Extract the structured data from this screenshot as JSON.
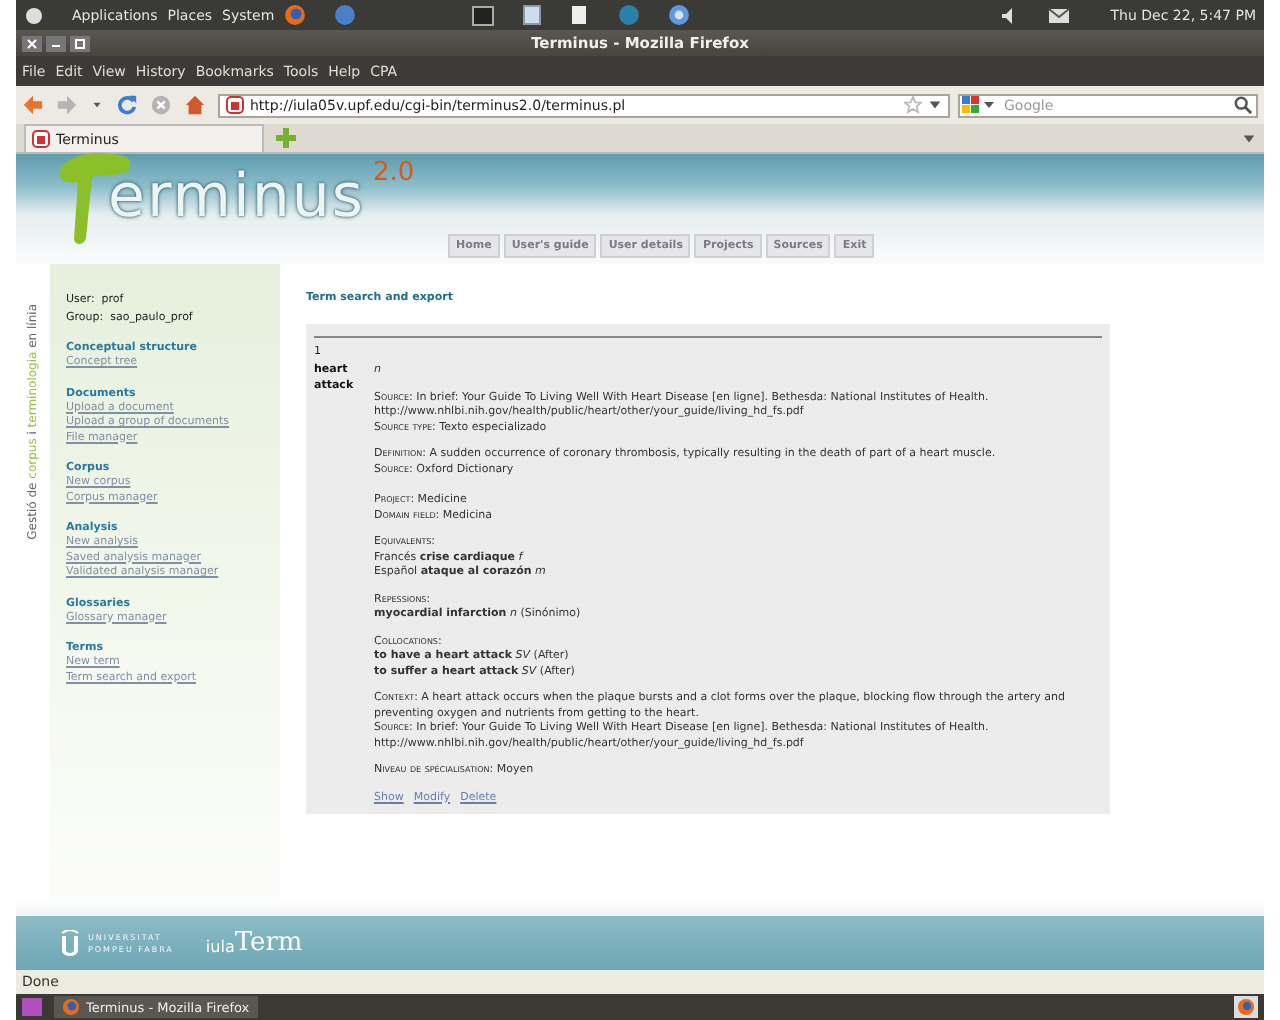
{
  "top_panel": {
    "menus": [
      "Applications",
      "Places",
      "System"
    ],
    "clock": "Thu Dec 22,  5:47 PM"
  },
  "window": {
    "title": "Terminus - Mozilla Firefox"
  },
  "menubar": [
    "File",
    "Edit",
    "View",
    "History",
    "Bookmarks",
    "Tools",
    "Help",
    "CPA"
  ],
  "toolbar": {
    "buttons": [
      {
        "kind": "back",
        "disabled": false
      },
      {
        "kind": "forward",
        "disabled": true
      },
      {
        "kind": "history",
        "disabled": false
      },
      {
        "kind": "reload",
        "disabled": false
      },
      {
        "kind": "stop",
        "disabled": true
      },
      {
        "kind": "home",
        "disabled": false
      }
    ],
    "url": "http://iula05v.upf.edu/cgi-bin/terminus2.0/terminus.pl",
    "search": {
      "placeholder": "Google"
    }
  },
  "tabs": [
    {
      "label": "Terminus",
      "selected": true
    }
  ],
  "site": {
    "logo": "erminus",
    "version": "2.0",
    "nav": [
      "Home",
      "User's guide",
      "User details",
      "Projects",
      "Sources",
      "Exit"
    ],
    "side_caption": [
      {
        "text": "Gestió de ",
        "highlight": false
      },
      {
        "text": "corpus",
        "highlight": true
      },
      {
        "text": " i ",
        "highlight": false
      },
      {
        "text": "terminologia",
        "highlight": true
      },
      {
        "text": " en línia",
        "highlight": false
      }
    ],
    "user": [
      {
        "label": "User:",
        "value": "prof"
      },
      {
        "label": "Group:",
        "value": "sao_paulo_prof"
      }
    ],
    "sidebar": [
      {
        "title": "Conceptual structure",
        "links": [
          "Concept tree"
        ]
      },
      {
        "title": "Documents",
        "links": [
          "Upload a document",
          "Upload a group of documents",
          "File manager"
        ]
      },
      {
        "title": "Corpus",
        "links": [
          "New corpus",
          "Corpus manager"
        ]
      },
      {
        "title": "Analysis",
        "links": [
          "New analysis",
          "Saved analysis manager",
          "Validated analysis manager"
        ]
      },
      {
        "title": "Glossaries",
        "links": [
          "Glossary manager"
        ]
      },
      {
        "title": "Terms",
        "links": [
          "New term",
          "Term search and export"
        ]
      }
    ],
    "page_title": "Term search and export",
    "entry": {
      "number": "1",
      "term": "heart attack",
      "pos": "n",
      "blocks": [
        [
          {
            "label": "Source:",
            "text": "In brief: Your Guide To Living Well With Heart Disease [en ligne]. Bethesda: National Institutes of Health. http://www.nhlbi.nih.gov/health/public/heart/other/your_guide/living_hd_fs.pdf"
          },
          {
            "label": "Source type:",
            "text": "Texto especializado"
          }
        ],
        [
          {
            "label": "Definition:",
            "text": "A sudden occurrence of coronary thrombosis, typically resulting in the death of part of a heart muscle."
          },
          {
            "label": "Source:",
            "text": "Oxford Dictionary"
          }
        ],
        [
          {
            "label": "Project:",
            "text": "Medicine"
          },
          {
            "label": "Domain field:",
            "text": "Medicina"
          }
        ],
        [
          {
            "label": "Equivalents:"
          },
          {
            "text": "Francés **crise cardiaque** *f*"
          },
          {
            "text": "Español **ataque al corazón** *m*"
          }
        ],
        [
          {
            "label": "Repessions:"
          },
          {
            "text": "**myocardial infarction** *n* (Sinónimo)"
          }
        ],
        [
          {
            "label": "Collocations:"
          },
          {
            "text": "**to have a heart attack** *SV* (After)"
          },
          {
            "text": "**to suffer a heart attack** *SV* (After)"
          }
        ],
        [
          {
            "label": "Context:",
            "text": "A heart attack occurs when the plaque bursts and a clot forms over the plaque, blocking flow through the artery and preventing oxygen and nutrients from getting to the heart."
          },
          {
            "label": "Source:",
            "text": "In brief: Your Guide To Living Well With Heart Disease [en ligne]. Bethesda: National Institutes of Health. http://www.nhlbi.nih.gov/health/public/heart/other/your_guide/living_hd_fs.pdf"
          }
        ],
        [
          {
            "label": "Niveau de spécialisation:",
            "text": "Moyen"
          }
        ]
      ],
      "actions": [
        "Show",
        "Modify",
        "Delete"
      ]
    },
    "footer": {
      "university": [
        "UNIVERSITAT",
        "POMPEU FABRA"
      ],
      "brand_small": "iula",
      "brand_large": "Term"
    }
  },
  "status_bar": "Done",
  "taskbar": {
    "window": "Terminus - Mozilla Firefox"
  }
}
